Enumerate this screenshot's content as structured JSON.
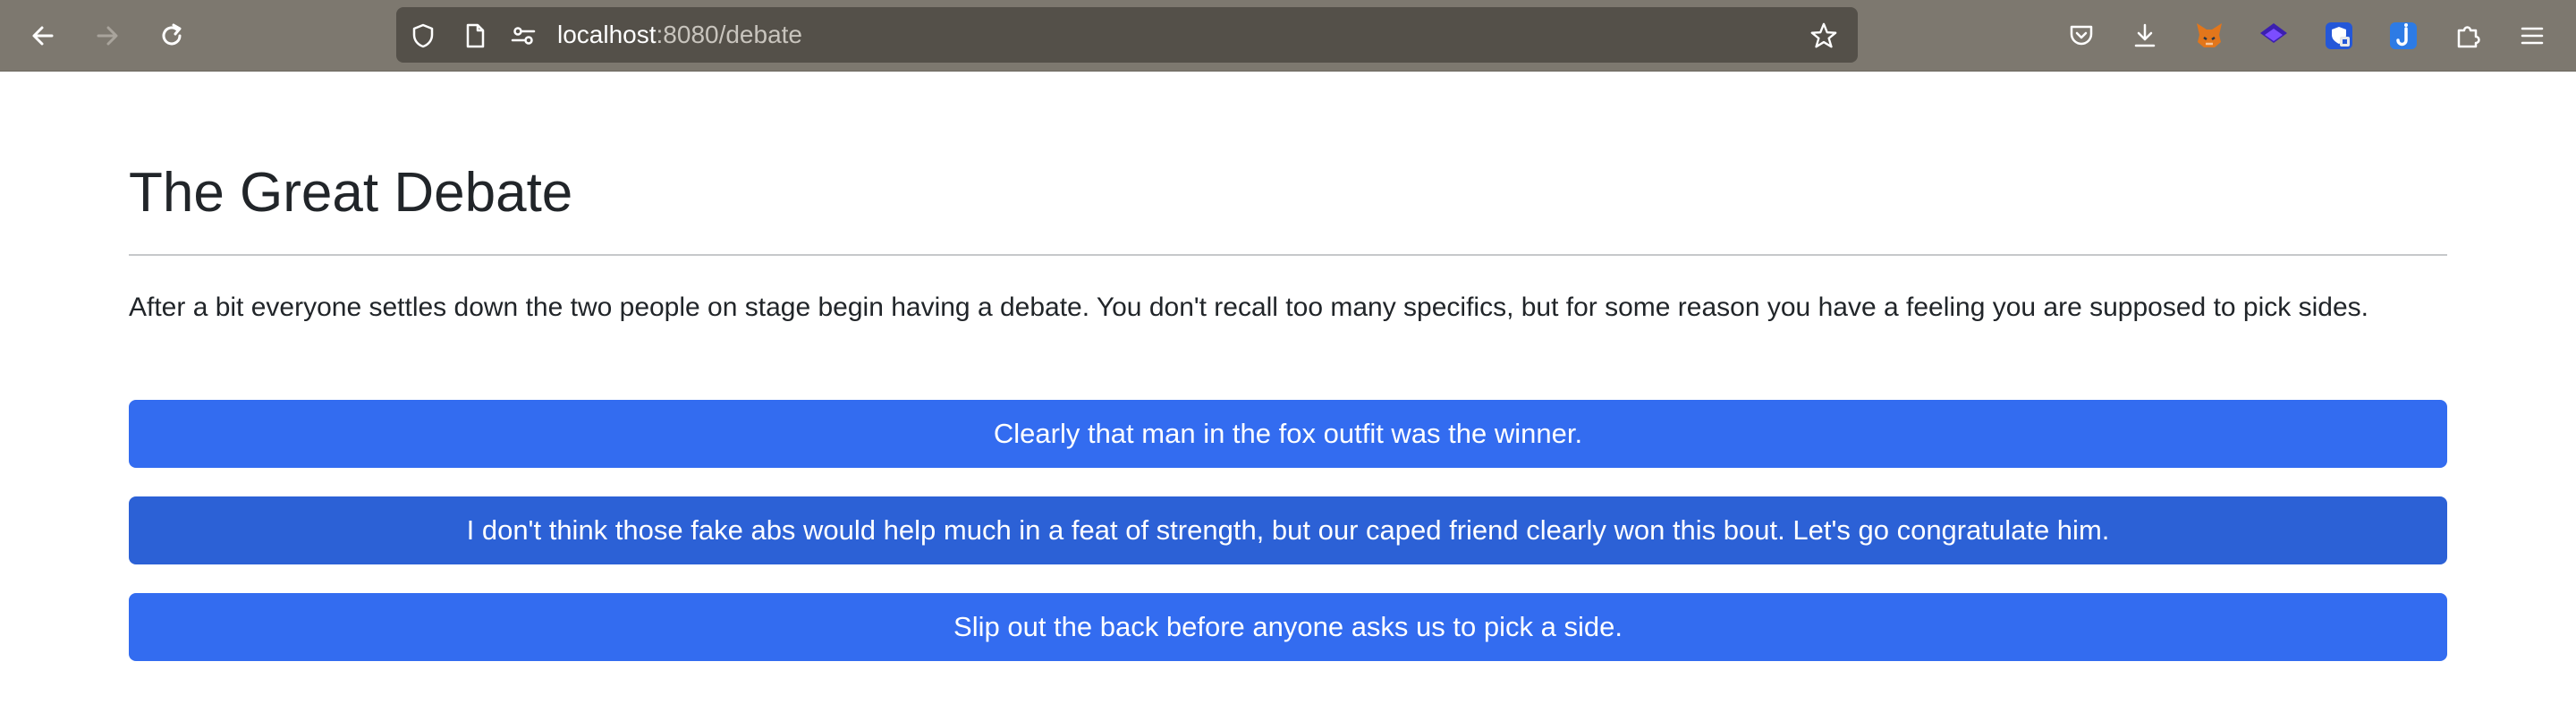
{
  "browser": {
    "url_host": "localhost",
    "url_rest": ":8080/debate",
    "back_icon": "arrow-left-icon",
    "forward_icon": "arrow-right-icon",
    "reload_icon": "reload-icon",
    "bookmark_icon": "star-icon",
    "extensions": [
      {
        "name": "pocket-icon"
      },
      {
        "name": "download-icon"
      },
      {
        "name": "metamask-fox-icon"
      },
      {
        "name": "layers-icon"
      },
      {
        "name": "shield-lock-icon"
      },
      {
        "name": "j-extension-icon"
      },
      {
        "name": "puzzle-icon"
      },
      {
        "name": "hamburger-menu-icon"
      }
    ]
  },
  "page": {
    "title": "The Great Debate",
    "body": "After a bit everyone settles down the two people on stage begin having a debate. You don't recall too many specifics, but for some reason you have a feeling you are supposed to pick sides.",
    "choices": [
      {
        "label": "Clearly that man in the fox outfit was the winner."
      },
      {
        "label": "I don't think those fake abs would help much in a feat of strength, but our caped friend clearly won this bout. Let's go congratulate him."
      },
      {
        "label": "Slip out the back before anyone asks us to pick a side."
      }
    ]
  },
  "colors": {
    "toolbar": "#7d786f",
    "urlbar": "#545049",
    "button": "#336cf0",
    "button_hover": "#2c61d6",
    "text": "#212529"
  }
}
